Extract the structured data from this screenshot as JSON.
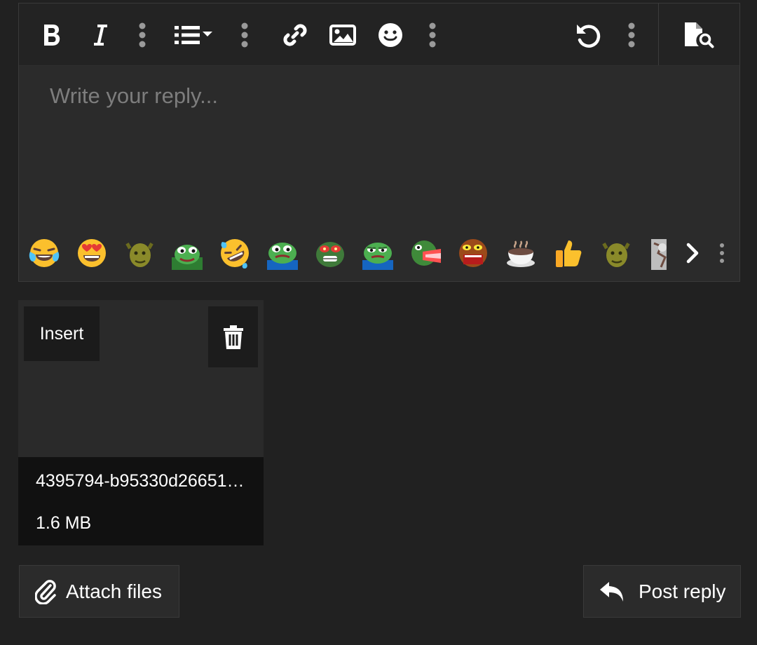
{
  "editor": {
    "placeholder": "Write your reply...",
    "toolbar": [
      {
        "name": "bold-button",
        "icon": "bold-icon"
      },
      {
        "name": "italic-button",
        "icon": "italic-icon"
      },
      {
        "name": "more-text-button",
        "icon": "more-vertical-icon"
      },
      {
        "name": "list-dropdown-button",
        "icon": "list-icon"
      },
      {
        "name": "more-paragraph-button",
        "icon": "more-vertical-icon"
      },
      {
        "name": "link-button",
        "icon": "link-icon"
      },
      {
        "name": "image-button",
        "icon": "image-icon"
      },
      {
        "name": "smilies-button",
        "icon": "smiley-icon"
      },
      {
        "name": "more-insert-button",
        "icon": "more-vertical-icon"
      },
      {
        "name": "undo-button",
        "icon": "undo-icon"
      },
      {
        "name": "more-misc-button",
        "icon": "more-vertical-icon"
      },
      {
        "name": "preview-button",
        "icon": "document-search-icon"
      }
    ],
    "emoji_bar": [
      "joy-emoji",
      "heart-eyes-emoji",
      "shrek-emoji",
      "pepe-smile-emoji",
      "rofl-emoji",
      "pepe-sad-emoji",
      "pepe-angry-red-eyes-emoji",
      "pepe-feelsbadman-emoji",
      "pepe-screaming-emoji",
      "pepe-rage-emoji",
      "hot-beverage-emoji",
      "thumbs-up-emoji",
      "shrek-emoji",
      "statue-emoji"
    ]
  },
  "attachment": {
    "insert_label": "Insert",
    "file_name": "4395794-b95330d26651…",
    "file_size": "1.6 MB"
  },
  "actions": {
    "attach_label": "Attach files",
    "post_label": "Post reply"
  },
  "colors": {
    "page_bg": "#212121",
    "editor_bg": "#2b2b2b",
    "toolbar_bg": "#232323",
    "file_info_bg": "#111111",
    "placeholder": "#7d7d7d"
  }
}
